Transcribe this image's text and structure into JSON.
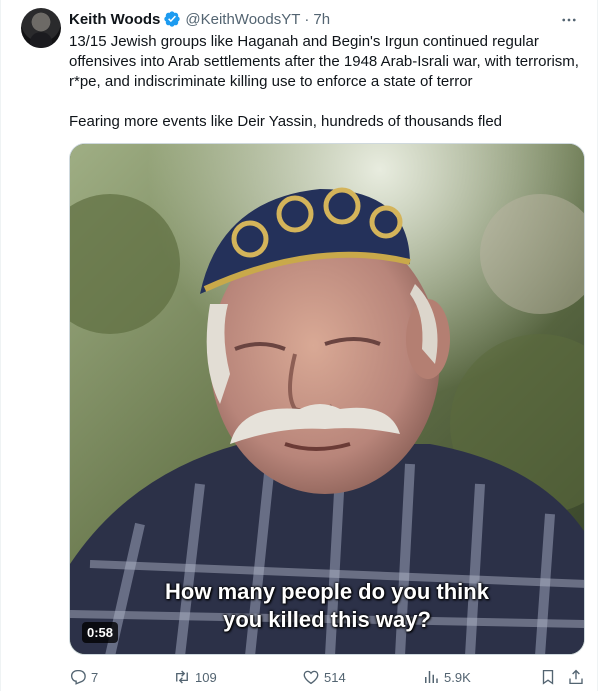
{
  "author": {
    "name": "Keith Woods",
    "handle": "@KeithWoodsYT",
    "separator": "·",
    "time": "7h",
    "verified": true
  },
  "tweet": {
    "paragraph1": "13/15 Jewish groups like Haganah and Begin's Irgun continued regular offensives into Arab settlements after the 1948 Arab-Israli war, with terrorism, r*pe, and indiscriminate killing use to enforce a state of terror",
    "paragraph2": "Fearing more events like Deir Yassin, hundreds of thousands fled"
  },
  "media": {
    "subtitle_line1": "How many people do you think",
    "subtitle_line2": "you killed this way?",
    "duration": "0:58"
  },
  "actions": {
    "replies": "7",
    "reposts": "109",
    "likes": "514",
    "views": "5.9K"
  },
  "colors": {
    "verified": "#1d9bf0",
    "muted": "#536471",
    "text": "#0f1419"
  },
  "icons": [
    "verified-badge-icon",
    "more-icon",
    "reply-icon",
    "repost-icon",
    "like-icon",
    "views-icon",
    "bookmark-icon",
    "share-icon"
  ]
}
